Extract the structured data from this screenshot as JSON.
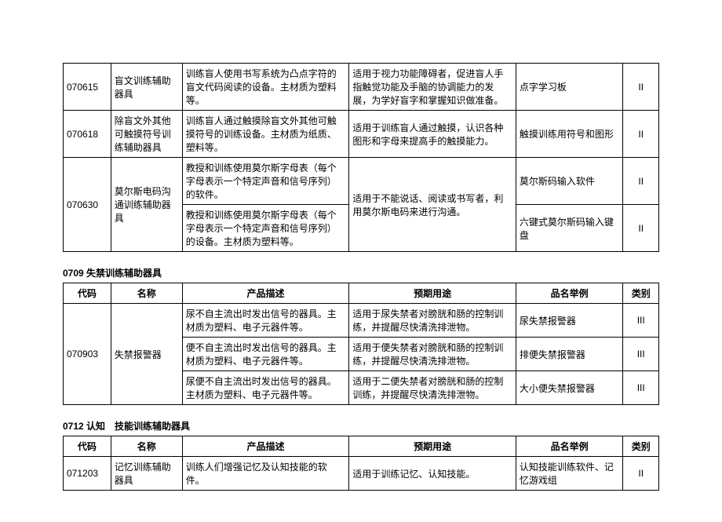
{
  "table1": {
    "rows": [
      {
        "code": "070615",
        "name": "盲文训练辅助器具",
        "desc": "训练盲人使用书写系统为凸点字符的盲文代码阅读的设备。主材质为塑料等。",
        "use": "适用于视力功能障碍者，促进盲人手指触觉功能及手脑的协调能力的发展，为学好盲字和掌握知识做准备。",
        "example": "点字学习板",
        "category": "II"
      },
      {
        "code": "070618",
        "name": "除盲文外其他可触摸符号训练辅助器具",
        "desc": "训练盲人通过触摸除盲文外其他可触摸符号的训练设备。主材质为纸质、塑料等。",
        "use": "适用于训练盲人通过触摸，认识各种图形和字母来提高手的触摸能力。",
        "example": "触摸训练用符号和图形",
        "category": "II"
      },
      {
        "code": "070630",
        "name": "莫尔斯电码沟通训练辅助器具",
        "sub": [
          {
            "desc": "教授和训练使用莫尔斯字母表（每个字母表示一个特定声音和信号序列）的软件。",
            "example": "莫尔斯码输入软件",
            "category": "II"
          },
          {
            "desc": "教授和训练使用莫尔斯字母表（每个字母表示一个特定声音和信号序列）的设备。主材质为塑料等。",
            "example": "六键式莫尔斯码输入键盘",
            "category": "II"
          }
        ],
        "sharedUse": "适用于不能说话、阅读或书写者，利用莫尔斯电码来进行沟通。"
      }
    ]
  },
  "section2": {
    "title": "0709 失禁训练辅助器具",
    "headers": {
      "code": "代码",
      "name": "名称",
      "desc": "产品描述",
      "use": "预期用途",
      "example": "品名举例",
      "category": "类别"
    },
    "row": {
      "code": "070903",
      "name": "失禁报警器",
      "sub": [
        {
          "desc": "尿不自主流出时发出信号的器具。主材质为塑料、电子元器件等。",
          "use": "适用于尿失禁者对膀胱和肠的控制训练，并提醒尽快清洗排泄物。",
          "example": "尿失禁报警器",
          "category": "III"
        },
        {
          "desc": "便不自主流出时发出信号的器具。主材质为塑料、电子元器件等。",
          "use": "适用于便失禁者对膀胱和肠的控制训练，并提醒尽快清洗排泄物。",
          "example": "排便失禁报警器",
          "category": "III"
        },
        {
          "desc": "尿便不自主流出时发出信号的器具。主材质为塑料、电子元器件等。",
          "use": "适用于二便失禁者对膀胱和肠的控制训练，并提醒尽快清洗排泄物。",
          "example": "大小便失禁报警器",
          "category": "III"
        }
      ]
    }
  },
  "section3": {
    "title": "0712 认知　技能训练辅助器具",
    "headers": {
      "code": "代码",
      "name": "名称",
      "desc": "产品描述",
      "use": "预期用途",
      "example": "品名举例",
      "category": "类别"
    },
    "row": {
      "code": "071203",
      "name": "记忆训练辅助器具",
      "desc": "训练人们增强记忆及认知技能的软件。",
      "use": "适用于训练记忆、认知技能。",
      "example": "认知技能训练软件、记忆游戏组",
      "category": "II"
    }
  }
}
